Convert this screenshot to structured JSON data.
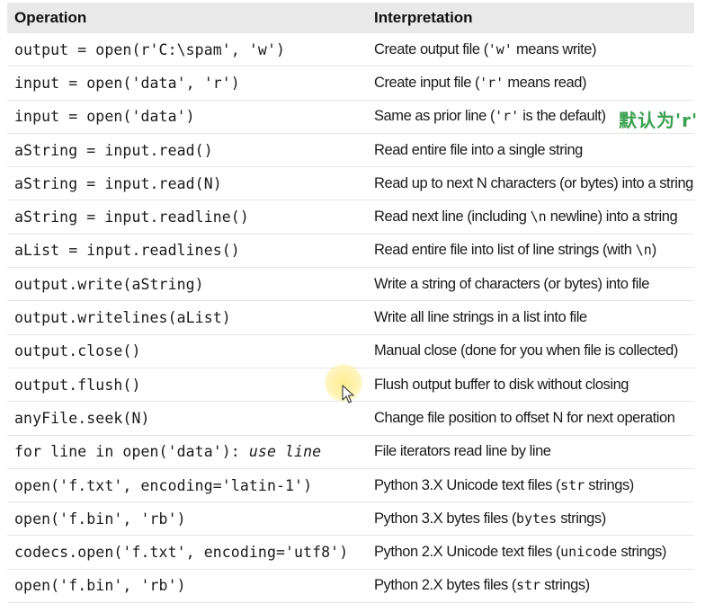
{
  "table": {
    "headers": {
      "operation": "Operation",
      "interpretation": "Interpretation"
    },
    "rows": [
      {
        "op": [
          {
            "t": "output = open(r'C:\\spam', 'w')"
          }
        ],
        "interp": [
          {
            "t": "Create output file ("
          },
          {
            "t": "'w'",
            "code": true
          },
          {
            "t": " means write)"
          }
        ]
      },
      {
        "op": [
          {
            "t": "input = open('data', 'r')"
          }
        ],
        "interp": [
          {
            "t": "Create input file ("
          },
          {
            "t": "'r'",
            "code": true
          },
          {
            "t": " means read)"
          }
        ]
      },
      {
        "op": [
          {
            "t": "input = open('data')"
          }
        ],
        "interp": [
          {
            "t": "Same as prior line ("
          },
          {
            "t": "'r'",
            "code": true
          },
          {
            "t": " is the default)"
          }
        ]
      },
      {
        "op": [
          {
            "t": "aString = input.read()"
          }
        ],
        "interp": [
          {
            "t": "Read entire file into a single string"
          }
        ]
      },
      {
        "op": [
          {
            "t": "aString = input.read(N)"
          }
        ],
        "interp": [
          {
            "t": "Read up to next N characters (or bytes) into a string"
          }
        ]
      },
      {
        "op": [
          {
            "t": "aString = input.readline()"
          }
        ],
        "interp": [
          {
            "t": "Read next line (including "
          },
          {
            "t": "\\n",
            "code": true
          },
          {
            "t": " newline) into a string"
          }
        ]
      },
      {
        "op": [
          {
            "t": "aList = input.readlines()"
          }
        ],
        "interp": [
          {
            "t": "Read entire file into list of line strings (with "
          },
          {
            "t": "\\n",
            "code": true
          },
          {
            "t": ")"
          }
        ]
      },
      {
        "op": [
          {
            "t": "output.write(aString)"
          }
        ],
        "interp": [
          {
            "t": "Write a string of characters (or bytes) into file"
          }
        ]
      },
      {
        "op": [
          {
            "t": "output.writelines(aList)"
          }
        ],
        "interp": [
          {
            "t": "Write all line strings in a list into file"
          }
        ]
      },
      {
        "op": [
          {
            "t": "output.close()"
          }
        ],
        "interp": [
          {
            "t": "Manual close (done for you when file is collected)"
          }
        ]
      },
      {
        "op": [
          {
            "t": "output.flush()"
          }
        ],
        "interp": [
          {
            "t": "Flush output buffer to disk without closing"
          }
        ]
      },
      {
        "op": [
          {
            "t": "anyFile.seek(N)"
          }
        ],
        "interp": [
          {
            "t": "Change file position to offset N for next operation"
          }
        ]
      },
      {
        "op": [
          {
            "t": "for line in open('data'): "
          },
          {
            "t": "use line",
            "italic": true
          }
        ],
        "interp": [
          {
            "t": "File iterators read line by line"
          }
        ]
      },
      {
        "op": [
          {
            "t": "open('f.txt', encoding='latin-1')"
          }
        ],
        "interp": [
          {
            "t": "Python 3.X Unicode text files ("
          },
          {
            "t": "str",
            "code": true
          },
          {
            "t": " strings)"
          }
        ]
      },
      {
        "op": [
          {
            "t": "open('f.bin', 'rb')"
          }
        ],
        "interp": [
          {
            "t": "Python 3.X bytes files ("
          },
          {
            "t": "bytes",
            "code": true
          },
          {
            "t": " strings)"
          }
        ]
      },
      {
        "op": [
          {
            "t": "codecs.open('f.txt', encoding='utf8')"
          }
        ],
        "interp": [
          {
            "t": "Python 2.X Unicode text files ("
          },
          {
            "t": "unicode",
            "code": true
          },
          {
            "t": " strings)"
          }
        ]
      },
      {
        "op": [
          {
            "t": "open('f.bin', 'rb')"
          }
        ],
        "interp": [
          {
            "t": "Python 2.X bytes files ("
          },
          {
            "t": "str",
            "code": true
          },
          {
            "t": " strings)"
          }
        ]
      }
    ]
  },
  "annotation": {
    "text": "默认为'r'",
    "color": "#3aa050"
  },
  "cursor": {
    "icon": "arrow-pointer-icon",
    "highlight_color": "#ffec8c"
  }
}
